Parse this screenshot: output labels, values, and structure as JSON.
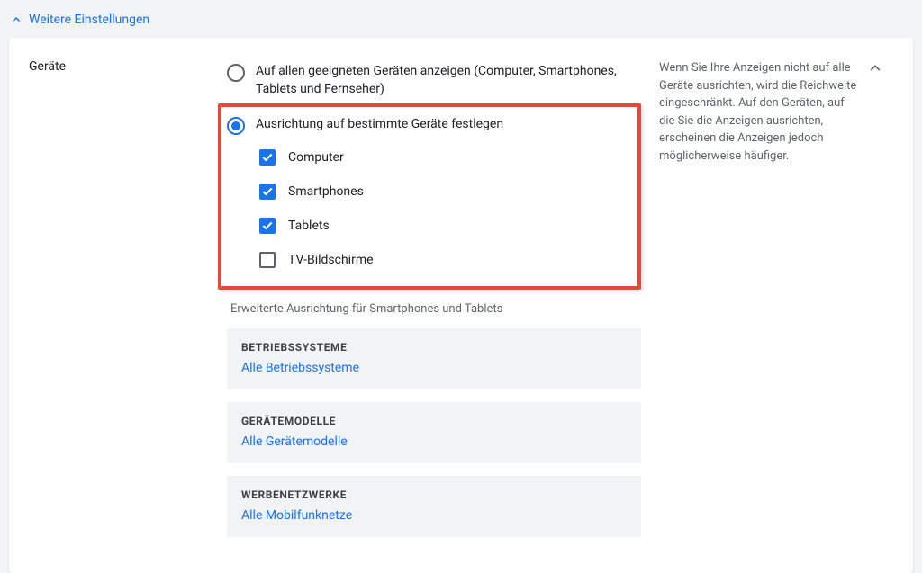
{
  "toggleHeader": "Weitere Einstellungen",
  "section": {
    "title": "Geräte",
    "help": "Wenn Sie Ihre Anzeigen nicht auf alle Geräte ausrichten, wird die Reichweite eingeschränkt. Auf den Geräten, auf die Sie die Anzeigen ausrichten, erscheinen die Anzeigen jedoch möglicherweise häufiger."
  },
  "radios": {
    "all": "Auf allen geeigneten Geräten anzeigen (Computer, Smartphones, Tablets und Fernseher)",
    "specific": "Ausrichtung auf bestimmte Geräte festlegen"
  },
  "devices": {
    "computer": "Computer",
    "smartphones": "Smartphones",
    "tablets": "Tablets",
    "tv": "TV-Bildschirme"
  },
  "advancedLabel": "Erweiterte Ausrichtung für Smartphones und Tablets",
  "panels": {
    "os": {
      "title": "BETRIEBSSYSTEME",
      "link": "Alle Betriebssysteme"
    },
    "models": {
      "title": "GERÄTEMODELLE",
      "link": "Alle Gerätemodelle"
    },
    "networks": {
      "title": "WERBENETZWERKE",
      "link": "Alle Mobilfunknetze"
    }
  }
}
